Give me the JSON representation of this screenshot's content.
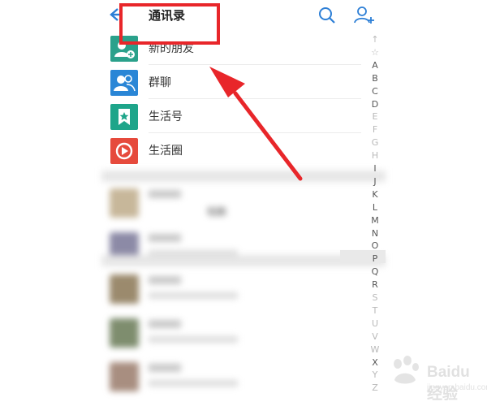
{
  "header": {
    "title": "通讯录"
  },
  "entries": [
    {
      "label": "新的朋友",
      "color": "#2aa18b",
      "icon": "new-friend-icon"
    },
    {
      "label": "群聊",
      "color": "#2a86d6",
      "icon": "group-chat-icon"
    },
    {
      "label": "生活号",
      "color": "#1ea58a",
      "icon": "life-account-icon"
    },
    {
      "label": "生活圈",
      "color": "#e64a3c",
      "icon": "life-circle-icon"
    }
  ],
  "blurred_contact_text": "程鹏",
  "index_letters": [
    "↑",
    "☆",
    "A",
    "B",
    "C",
    "D",
    "E",
    "F",
    "G",
    "H",
    "I",
    "J",
    "K",
    "L",
    "M",
    "N",
    "O",
    "P",
    "Q",
    "R",
    "S",
    "T",
    "U",
    "V",
    "W",
    "X",
    "Y",
    "Z"
  ],
  "watermark": {
    "text": "Baidu 经验",
    "sub": "jingyan.baidu.com"
  },
  "colors": {
    "accent": "#2d7fd6",
    "annotation_red": "#e8262a"
  }
}
